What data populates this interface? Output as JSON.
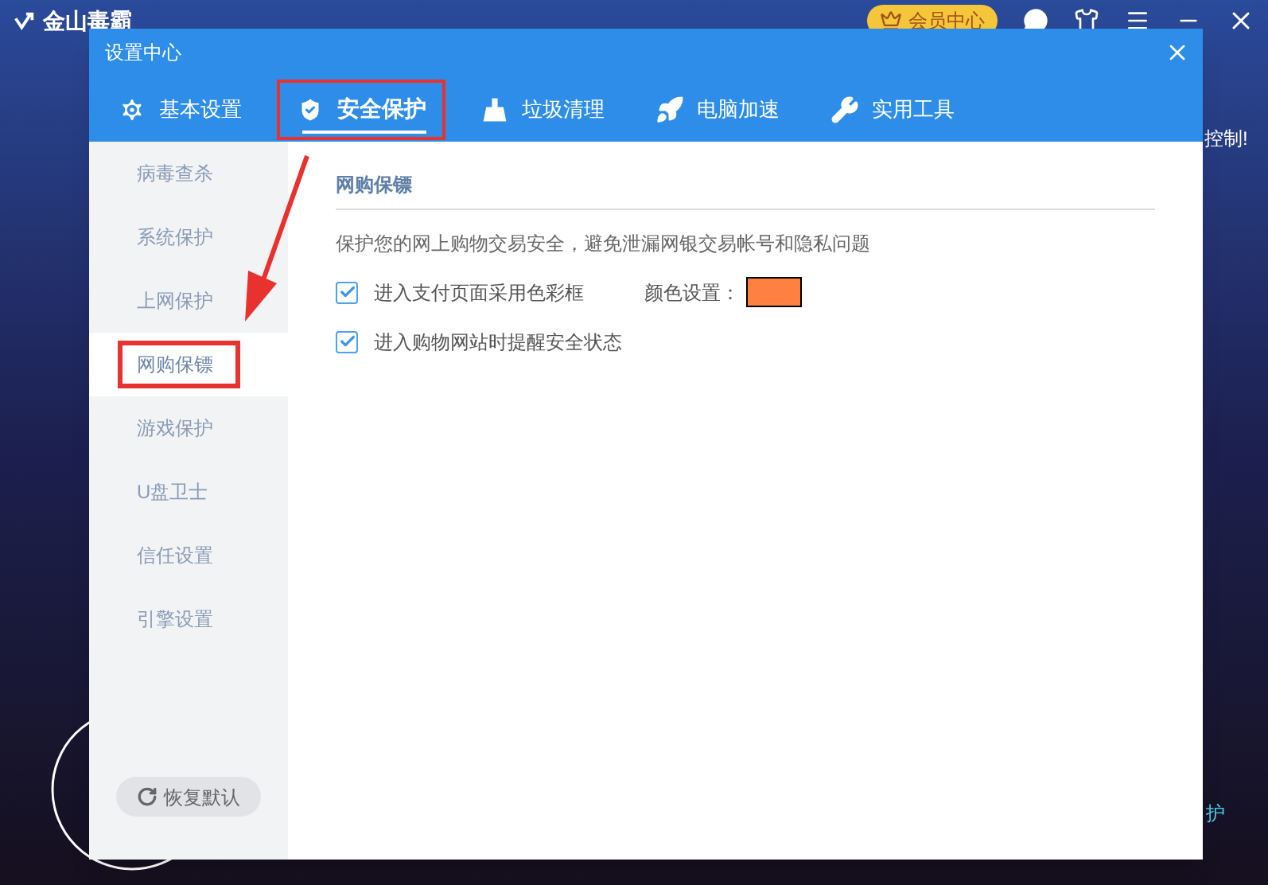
{
  "app": {
    "title": "金山毒霸",
    "member_button": "会员中心"
  },
  "background_texts": [
    "控制!",
    "护"
  ],
  "dialog": {
    "title": "设置中心",
    "tabs": [
      {
        "label": "基本设置",
        "selected": false
      },
      {
        "label": "安全保护",
        "selected": true
      },
      {
        "label": "垃圾清理",
        "selected": false
      },
      {
        "label": "电脑加速",
        "selected": false
      },
      {
        "label": "实用工具",
        "selected": false
      }
    ],
    "sidebar": {
      "items": [
        {
          "label": "病毒查杀",
          "selected": false
        },
        {
          "label": "系统保护",
          "selected": false
        },
        {
          "label": "上网保护",
          "selected": false
        },
        {
          "label": "网购保镖",
          "selected": true
        },
        {
          "label": "游戏保护",
          "selected": false
        },
        {
          "label": "U盘卫士",
          "selected": false
        },
        {
          "label": "信任设置",
          "selected": false
        },
        {
          "label": "引擎设置",
          "selected": false
        }
      ],
      "restore_button": "恢复默认"
    },
    "section": {
      "title": "网购保镖",
      "description": "保护您的网上购物交易安全，避免泄漏网银交易帐号和隐私问题",
      "options": [
        {
          "label": "进入支付页面采用色彩框",
          "checked": true,
          "color_setting": {
            "label": "颜色设置：",
            "color": "#ff8040"
          }
        },
        {
          "label": "进入购物网站时提醒安全状态",
          "checked": true
        }
      ]
    }
  }
}
